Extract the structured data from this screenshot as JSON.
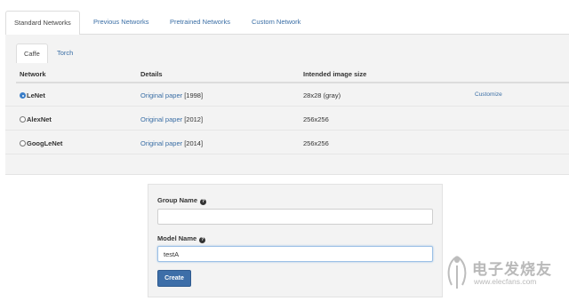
{
  "top_tabs": [
    {
      "label": "Standard Networks",
      "active": true
    },
    {
      "label": "Previous Networks",
      "active": false
    },
    {
      "label": "Pretrained Networks",
      "active": false
    },
    {
      "label": "Custom Network",
      "active": false
    }
  ],
  "framework_tabs": [
    {
      "label": "Caffe",
      "active": true
    },
    {
      "label": "Torch",
      "active": false
    }
  ],
  "table": {
    "headers": {
      "network": "Network",
      "details": "Details",
      "image_size": "Intended image size"
    },
    "rows": [
      {
        "name": "LeNet",
        "selected": true,
        "paper_link": "Original paper",
        "year": "[1998]",
        "image_size": "28x28 (gray)",
        "action": "Customize"
      },
      {
        "name": "AlexNet",
        "selected": false,
        "paper_link": "Original paper",
        "year": "[2012]",
        "image_size": "256x256",
        "action": ""
      },
      {
        "name": "GoogLeNet",
        "selected": false,
        "paper_link": "Original paper",
        "year": "[2014]",
        "image_size": "256x256",
        "action": ""
      }
    ]
  },
  "form": {
    "group_name_label": "Group Name",
    "group_name_value": "",
    "model_name_label": "Model Name",
    "model_name_value": "testA",
    "help_glyph": "?",
    "create_label": "Create"
  },
  "watermark": {
    "line1": "电子发烧友",
    "line2": "www.elecfans.com"
  },
  "colors": {
    "link": "#3a6ea5",
    "primary_button": "#3d6ea8",
    "panel_bg": "#f3f3f3"
  }
}
